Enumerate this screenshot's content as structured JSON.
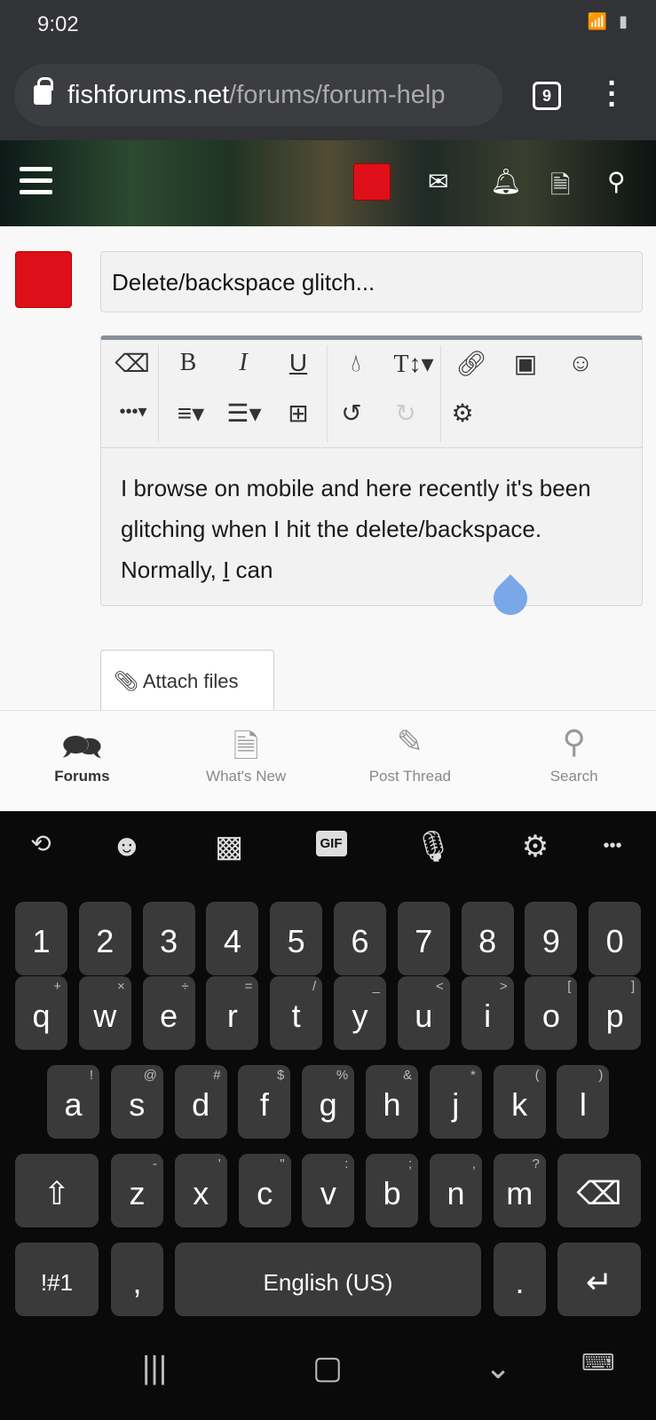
{
  "status": {
    "time": "9:02",
    "icons": "wifi 4G signal battery"
  },
  "browser": {
    "host": "fishforums.net",
    "path": "/forums/forum-help",
    "tab_count": "9"
  },
  "header": {
    "icons": [
      "menu-icon",
      "avatar",
      "mail-icon",
      "bell-icon",
      "document-icon",
      "search-icon"
    ]
  },
  "post": {
    "title": "Delete/backspace glitch...",
    "body_before": "I browse on mobile and here recently it's been glitching when I hit the delete/backspace. Normally, ",
    "body_caret": "I",
    "body_after": " can",
    "attach_label": "Attach files",
    "accent": "#de0f19"
  },
  "toolbar": {
    "row1": [
      "eraser-icon",
      "bold-icon",
      "italic-icon",
      "underline-icon",
      "color-icon",
      "text-size-icon",
      "link-icon",
      "image-icon",
      "smiley-icon"
    ],
    "row2": [
      "more-icon",
      "align-icon",
      "list-icon",
      "table-icon",
      "undo-icon",
      "redo-icon",
      "settings-icon"
    ]
  },
  "bottom_nav": [
    {
      "label": "Forums",
      "icon": "chat-icon",
      "active": true
    },
    {
      "label": "What's New",
      "icon": "document-icon"
    },
    {
      "label": "Post Thread",
      "icon": "edit-icon"
    },
    {
      "label": "Search",
      "icon": "search-icon"
    }
  ],
  "keyboard": {
    "numbers": [
      "1",
      "2",
      "3",
      "4",
      "5",
      "6",
      "7",
      "8",
      "9",
      "0"
    ],
    "row1": [
      [
        "q",
        "+"
      ],
      [
        "w",
        "×"
      ],
      [
        "e",
        "÷"
      ],
      [
        "r",
        "="
      ],
      [
        "t",
        "/"
      ],
      [
        "y",
        "_"
      ],
      [
        "u",
        "<"
      ],
      [
        "i",
        ">"
      ],
      [
        "o",
        "["
      ],
      [
        "p",
        "]"
      ]
    ],
    "row2": [
      [
        "a",
        "!"
      ],
      [
        "s",
        "@"
      ],
      [
        "d",
        "#"
      ],
      [
        "f",
        "$"
      ],
      [
        "g",
        "%"
      ],
      [
        "h",
        "&"
      ],
      [
        "j",
        "*"
      ],
      [
        "k",
        "("
      ],
      [
        "l",
        ")"
      ]
    ],
    "row3": [
      [
        "z",
        "-"
      ],
      [
        "x",
        "'"
      ],
      [
        "c",
        "\""
      ],
      [
        "v",
        ":"
      ],
      [
        "b",
        ";"
      ],
      [
        "n",
        ","
      ],
      [
        "m",
        "?"
      ]
    ],
    "symbols_label": "!#1",
    "comma": ",",
    "space_label": "English (US)",
    "period": ".",
    "gif_label": "GIF"
  }
}
